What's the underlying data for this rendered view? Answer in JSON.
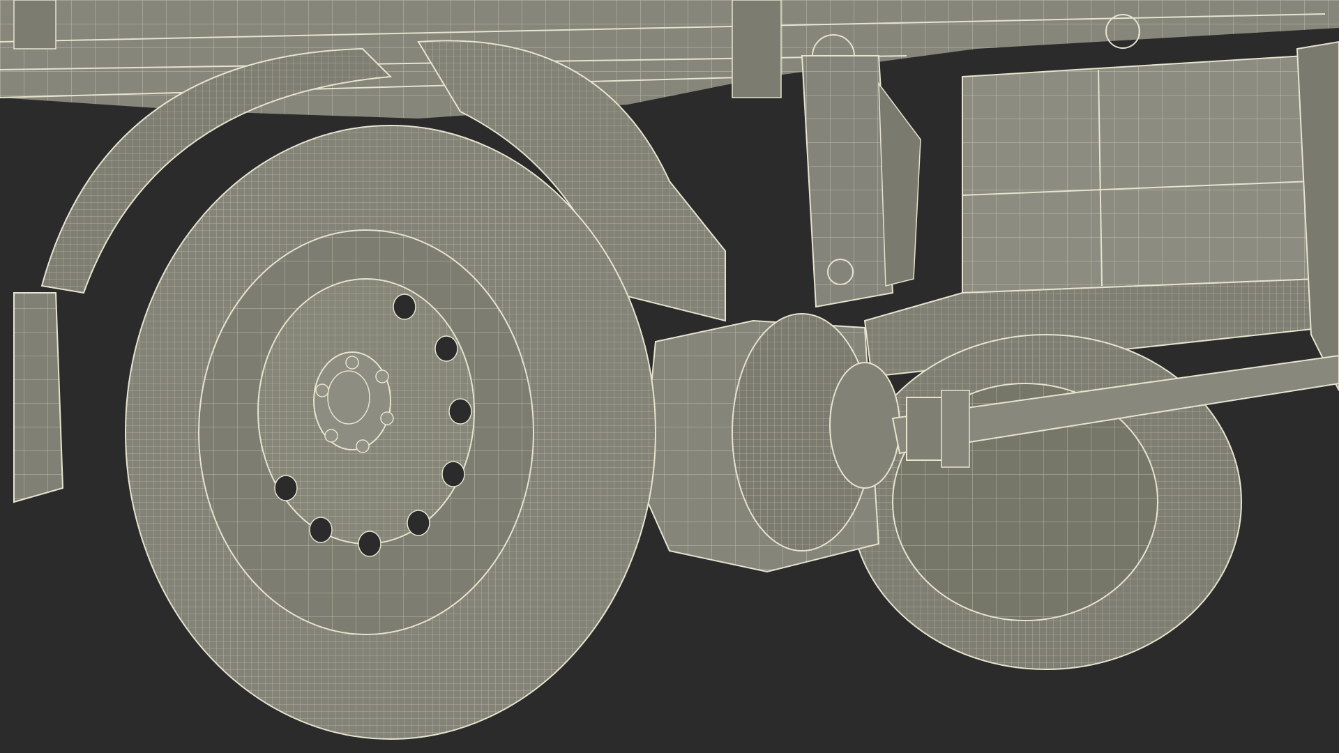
{
  "viewport": {
    "background_color": "#2b2b2b",
    "model_fill_color": "#8a8a7a",
    "model_shadow_color": "#6f6f63",
    "wireframe_color": "#e6e4cf"
  }
}
